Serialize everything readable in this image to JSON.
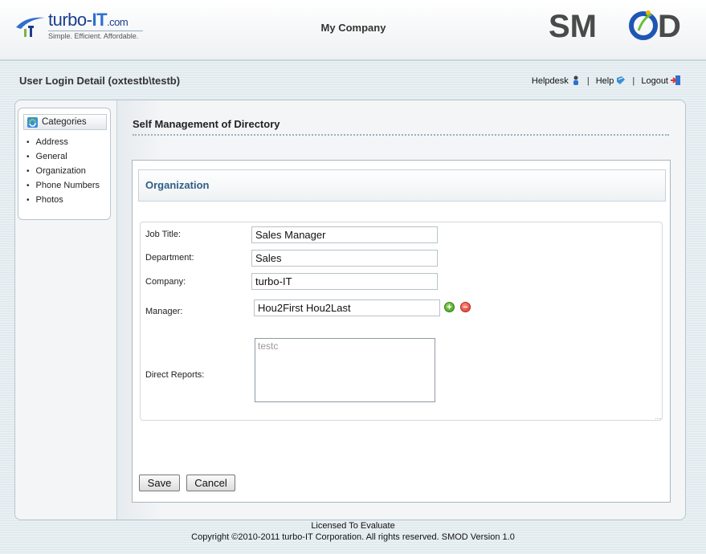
{
  "header": {
    "logo_brand_prefix": "turbo-",
    "logo_brand_it": "IT",
    "logo_brand_suffix": ".com",
    "logo_tagline": "Simple.  Efficient.  Affordable.",
    "company_title": "My Company",
    "right_logo": "SMOD"
  },
  "user_bar": {
    "login_detail": "User Login Detail (oxtestb\\testb)",
    "links": {
      "helpdesk": "Helpdesk",
      "help": "Help",
      "logout": "Logout",
      "separator": "|"
    }
  },
  "sidebar": {
    "header": "Categories",
    "items": [
      "Address",
      "General",
      "Organization",
      "Phone Numbers",
      "Photos"
    ]
  },
  "main": {
    "section_title": "Self Management of Directory",
    "panel_title": "Organization",
    "fields": {
      "job_title_label": "Job Title:",
      "job_title_value": "Sales Manager",
      "department_label": "Department:",
      "department_value": "Sales",
      "company_label": "Company:",
      "company_value": "turbo-IT",
      "manager_label": "Manager:",
      "manager_value": "Hou2First Hou2Last",
      "direct_reports_label": "Direct Reports:",
      "direct_reports_value": "testc"
    },
    "buttons": {
      "save": "Save",
      "cancel": "Cancel"
    }
  },
  "footer": {
    "license": "Licensed To Evaluate",
    "copyright": "Copyright ©2010-2011 turbo-IT Corporation. All rights reserved. SMOD Version 1.0"
  },
  "colors": {
    "panel_title": "#2f5e86",
    "add_icon": "#3f9a1c",
    "remove_icon": "#d8362a"
  }
}
